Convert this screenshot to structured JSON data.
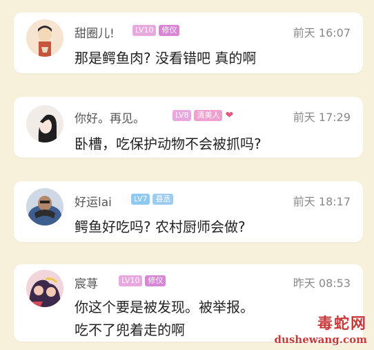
{
  "comments": [
    {
      "name": "甜圈儿!",
      "badges": [
        {
          "text": "LV10",
          "color": "#e9a7e0"
        },
        {
          "text": "修仪",
          "color": "#d985d6"
        }
      ],
      "time": "前天 16:07",
      "text": "那是鳄鱼肉? 没看错吧 真的啊",
      "avatar_colors": [
        "#f3d9b8",
        "#c7543d"
      ]
    },
    {
      "name": "你好。再见。",
      "badges": [
        {
          "text": "LV8",
          "color": "#e9a7e0"
        },
        {
          "text": "清美人",
          "color": "#f09fcf"
        }
      ],
      "has_heart": true,
      "time": "前天 17:29",
      "text": "卧槽，吃保护动物不会被抓吗?",
      "avatar_colors": [
        "#f6e6dc",
        "#2a2a2a"
      ]
    },
    {
      "name": "好运lai",
      "badges": [
        {
          "text": "LV7",
          "color": "#8fc8f0"
        },
        {
          "text": "县丞",
          "color": "#9cccf2"
        }
      ],
      "time": "前天 18:17",
      "text": "鳄鱼好吃吗? 农村厨师会做?",
      "avatar_colors": [
        "#3d5e8e",
        "#b0876a"
      ]
    },
    {
      "name": "宸荨",
      "badges": [
        {
          "text": "LV10",
          "color": "#e9a7e0"
        },
        {
          "text": "修仪",
          "color": "#d985d6"
        }
      ],
      "time": "昨天 08:53",
      "text": "你这个要是被发现。被举报。吃不了兜着走的啊",
      "avatar_colors": [
        "#f4c9b3",
        "#3d2a4a"
      ]
    }
  ],
  "watermark": {
    "top": "毒蛇网",
    "bottom": "dushewang.com"
  }
}
